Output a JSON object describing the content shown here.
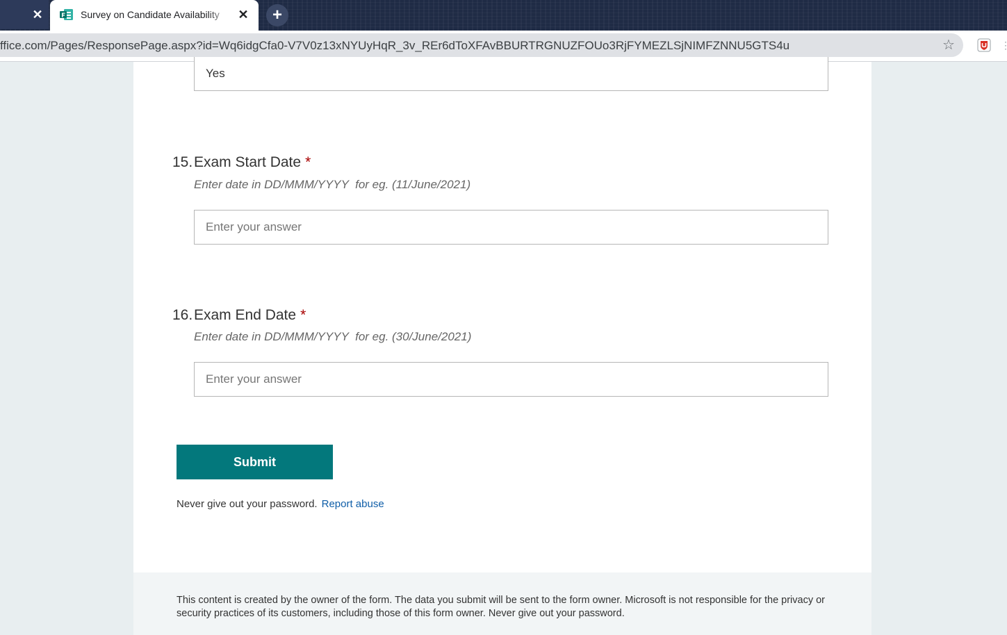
{
  "browser": {
    "tab_title": "Survey on Candidate Availability",
    "url": "ffice.com/Pages/ResponsePage.aspx?id=Wq6idgCfa0-V7V0z13xNYUyHqR_3v_REr6dToXFAvBBURTRGNUZFOUo3RjFYMEZLSjNIMFZNNU5GTS4u",
    "close_glyph": "✕",
    "newtab_glyph": "+",
    "star_glyph": "☆",
    "icons": {
      "forms_app": "forms-app-icon",
      "bookmark": "star-icon",
      "extension": "shield-extension-icon"
    },
    "colors": {
      "tabstrip": "#1f2b45",
      "omnibox": "#dfe1e5"
    }
  },
  "form": {
    "previous_answer": "Yes",
    "questions": [
      {
        "number": "15.",
        "title": "Exam Start Date",
        "required_mark": "*",
        "hint": "Enter date in DD/MMM/YYYY  for eg. (11/June/2021)",
        "placeholder": "Enter your answer"
      },
      {
        "number": "16.",
        "title": "Exam End Date",
        "required_mark": "*",
        "hint": "Enter date in DD/MMM/YYYY  for eg. (30/June/2021)",
        "placeholder": "Enter your answer"
      }
    ],
    "submit_label": "Submit",
    "password_note": "Never give out your password.",
    "report_link": "Report abuse",
    "disclaimer": "This content is created by the owner of the form. The data you submit will be sent to the form owner. Microsoft is not responsible for the privacy or security practices of its customers, including those of this form owner. Never give out your password.",
    "colors": {
      "accent": "#03787c",
      "required": "#a80000",
      "link": "#0f5ea8"
    }
  }
}
